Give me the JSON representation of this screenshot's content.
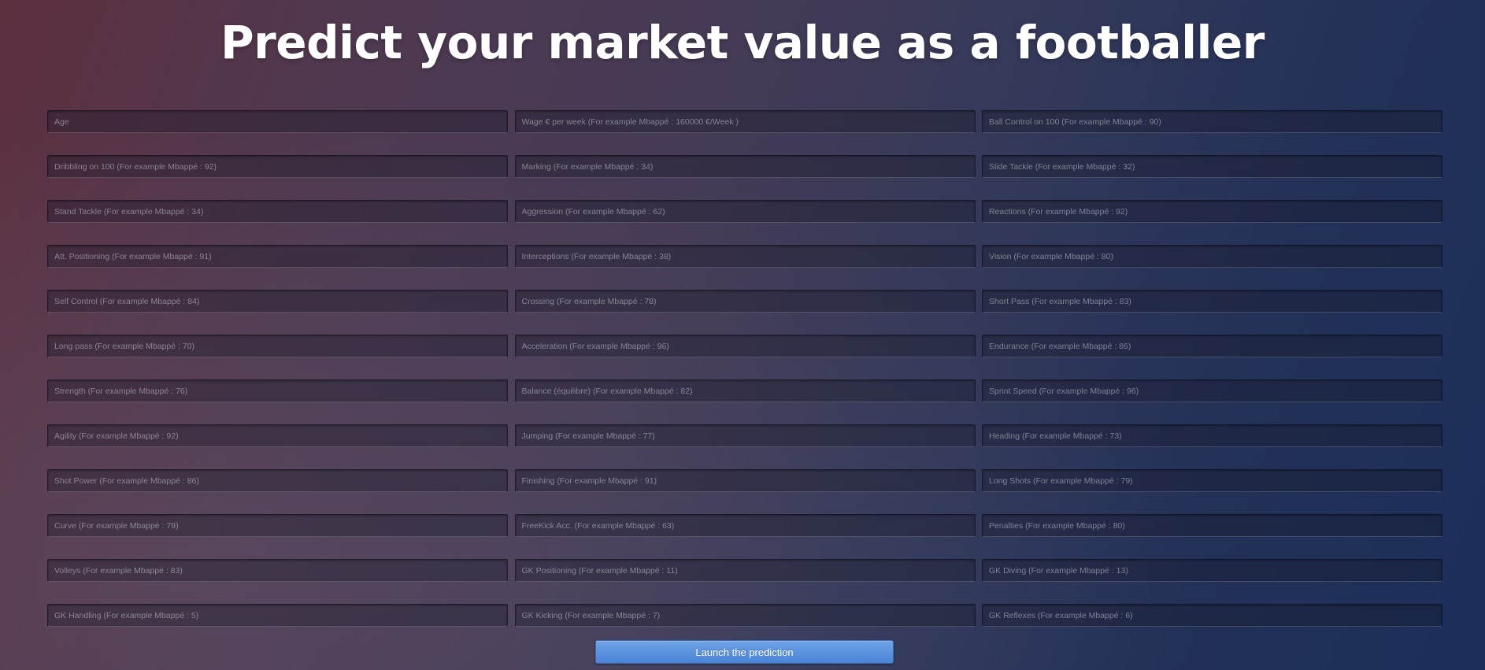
{
  "title": "Predict your market value as a footballer",
  "fields": [
    {
      "placeholder": "Age"
    },
    {
      "placeholder": "Wage € per week (For example Mbappé : 160000 €/Week )"
    },
    {
      "placeholder": "Ball Control on 100 (For example Mbappé : 90)"
    },
    {
      "placeholder": "Dribbling on 100 (For example Mbappé : 92)"
    },
    {
      "placeholder": "Marking (For example Mbappé : 34)"
    },
    {
      "placeholder": "Slide Tackle (For example Mbappé : 32)"
    },
    {
      "placeholder": "Stand Tackle (For example Mbappé : 34)"
    },
    {
      "placeholder": "Aggression (For example Mbappé : 62)"
    },
    {
      "placeholder": "Reactions (For example Mbappé : 92)"
    },
    {
      "placeholder": "Att. Positioning (For example Mbappé : 91)"
    },
    {
      "placeholder": "Interceptions (For example Mbappé : 38)"
    },
    {
      "placeholder": "Vision (For example Mbappé : 80)"
    },
    {
      "placeholder": "Self Control (For example Mbappé : 84)"
    },
    {
      "placeholder": "Crossing (For example Mbappé : 78)"
    },
    {
      "placeholder": "Short Pass (For example Mbappé : 83)"
    },
    {
      "placeholder": "Long pass (For example Mbappé : 70)"
    },
    {
      "placeholder": "Acceleration (For example Mbappé : 96)"
    },
    {
      "placeholder": "Endurance (For example Mbappé : 86)"
    },
    {
      "placeholder": "Strength (For example Mbappé : 76)"
    },
    {
      "placeholder": "Balance (équilibre) (For example Mbappé : 82)"
    },
    {
      "placeholder": "Sprint Speed (For example Mbappé : 96)"
    },
    {
      "placeholder": "Agility (For example Mbappé : 92)"
    },
    {
      "placeholder": "Jumping (For example Mbappé : 77)"
    },
    {
      "placeholder": "Heading (For example Mbappé : 73)"
    },
    {
      "placeholder": "Shot Power (For example Mbappé : 86)"
    },
    {
      "placeholder": "Finishing (For example Mbappé : 91)"
    },
    {
      "placeholder": "Long Shots (For example Mbappé : 79)"
    },
    {
      "placeholder": "Curve (For example Mbappé : 79)"
    },
    {
      "placeholder": "FreeKick Acc. (For example Mbappé : 63)"
    },
    {
      "placeholder": "Penalties (For example Mbappé : 80)"
    },
    {
      "placeholder": "Volleys (For example Mbappé : 83)"
    },
    {
      "placeholder": "GK Positioning (For example Mbappé : 11)"
    },
    {
      "placeholder": "GK Diving (For example Mbappé : 13)"
    },
    {
      "placeholder": "GK Handling (For example Mbappé : 5)"
    },
    {
      "placeholder": "GK Kicking (For example Mbappé : 7)"
    },
    {
      "placeholder": "GK Reflexes (For example Mbappé : 6)"
    }
  ],
  "submit_label": "Launch the prediction"
}
